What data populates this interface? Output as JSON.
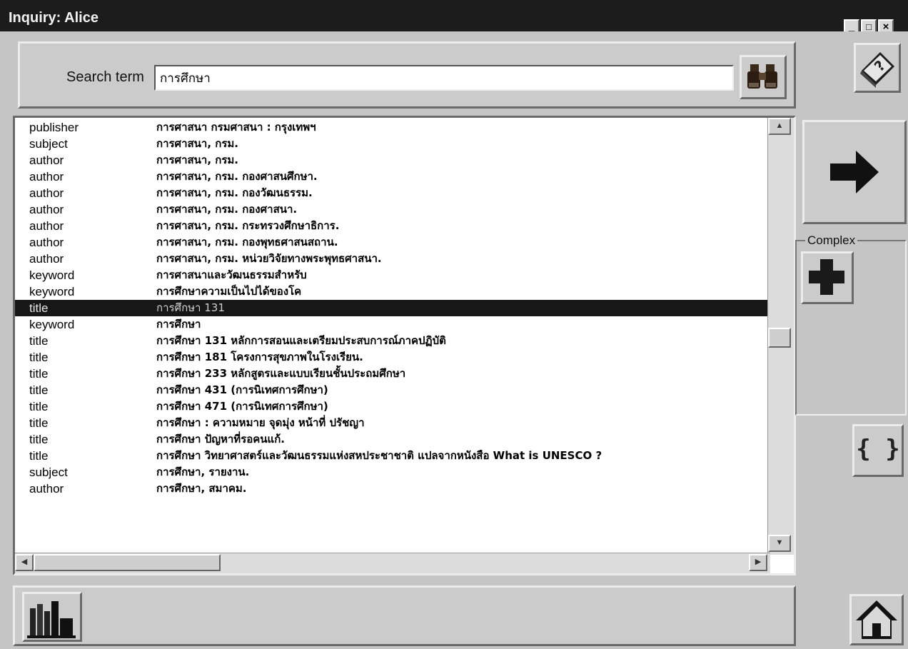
{
  "window": {
    "title": "Inquiry: Alice",
    "controls": [
      "_",
      "□",
      "×"
    ]
  },
  "search": {
    "label": "Search term",
    "value": "การศึกษา",
    "find_icon": "binoculars-icon"
  },
  "results": [
    {
      "type": "publisher",
      "value": "การศาสนา กรมศาสนา : กรุงเทพฯ"
    },
    {
      "type": "subject",
      "value": "การศาสนา, กรม."
    },
    {
      "type": "author",
      "value": "การศาสนา, กรม."
    },
    {
      "type": "author",
      "value": "การศาสนา, กรม. กองศาสนศึกษา."
    },
    {
      "type": "author",
      "value": "การศาสนา, กรม. กองวัฒนธรรม."
    },
    {
      "type": "author",
      "value": "การศาสนา, กรม. กองศาสนา."
    },
    {
      "type": "author",
      "value": "การศาสนา, กรม. กระทรวงศึกษาธิการ."
    },
    {
      "type": "author",
      "value": "การศาสนา, กรม. กองพุทธศาสนสถาน."
    },
    {
      "type": "author",
      "value": "การศาสนา, กรม. หน่วยวิจัยทางพระพุทธศาสนา."
    },
    {
      "type": "keyword",
      "value": "การศาสนาและวัฒนธรรมสำหรับ"
    },
    {
      "type": "keyword",
      "value": "การศึกษาความเป็นไปได้ของโค"
    },
    {
      "type": "title",
      "value": "การศึกษา 131",
      "selected": true
    },
    {
      "type": "keyword",
      "value": "การศึกษา"
    },
    {
      "type": "title",
      "value": "การศึกษา 131 หลักการสอนและเตรียมประสบการณ์ภาคปฏิบัติ"
    },
    {
      "type": "title",
      "value": "การศึกษา 181 โครงการสุขภาพในโรงเรียน."
    },
    {
      "type": "title",
      "value": "การศึกษา 233 หลักสูตรและแบบเรียนชั้นประถมศึกษา"
    },
    {
      "type": "title",
      "value": "การศึกษา 431 (การนิเทศการศึกษา)"
    },
    {
      "type": "title",
      "value": "การศึกษา 471 (การนิเทศการศึกษา)"
    },
    {
      "type": "title",
      "value": "การศึกษา : ความหมาย จุดมุ่ง หน้าที่ ปรัชญา"
    },
    {
      "type": "title",
      "value": "การศึกษา ปัญหาที่รอคนแก้."
    },
    {
      "type": "title",
      "value": "การศึกษา วิทยาศาสตร์และวัฒนธรรมแห่งสหประชาชาติ แปลจากหนังสือ What is UNESCO ?"
    },
    {
      "type": "subject",
      "value": "การศึกษา, รายงาน."
    },
    {
      "type": "author",
      "value": "การศึกษา, สมาคม."
    }
  ],
  "toolbar": {
    "complex_label": "Complex",
    "brace_label": "{ }",
    "help_icon": "help-book-icon",
    "next_icon": "arrow-right-icon",
    "add_icon": "plus-icon",
    "library_icon": "library-books-icon",
    "home_icon": "home-icon"
  },
  "colors": {
    "titlebar": "#1c1c1c",
    "selection": "#171717",
    "face": "#c9c9c9"
  }
}
